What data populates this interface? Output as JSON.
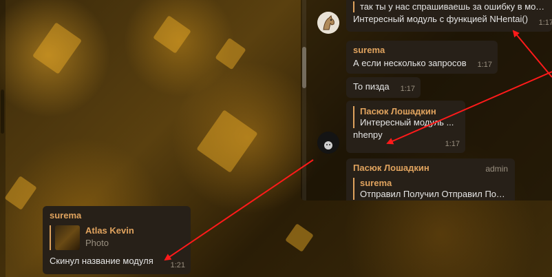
{
  "chat_popup": {
    "messages": [
      {
        "reply_text": "так ты у нас спрашиваешь за ошибку в мод...",
        "text": "Интересный модуль с функцией NHentai()",
        "time": "1:17"
      },
      {
        "sender": "surema",
        "text": "А если несколько запросов",
        "time": "1:17"
      },
      {
        "text": "То пизда",
        "time": "1:17"
      },
      {
        "reply_name": "Пасюк Лошадкин",
        "reply_text": "Интересный модуль ...",
        "text": "nhenpy",
        "time": "1:17"
      },
      {
        "sender": "Пасюк Лошадкин",
        "badge": "admin",
        "reply_name": "surema",
        "reply_text": "Отправил Получил Отправил Пол..."
      }
    ]
  },
  "main_message": {
    "sender": "surema",
    "reply_name": "Atlas Kevin",
    "reply_text": "Photo",
    "text": "Скинул название модуля",
    "time": "1:21"
  },
  "annotation_color": "#ff1a1a"
}
